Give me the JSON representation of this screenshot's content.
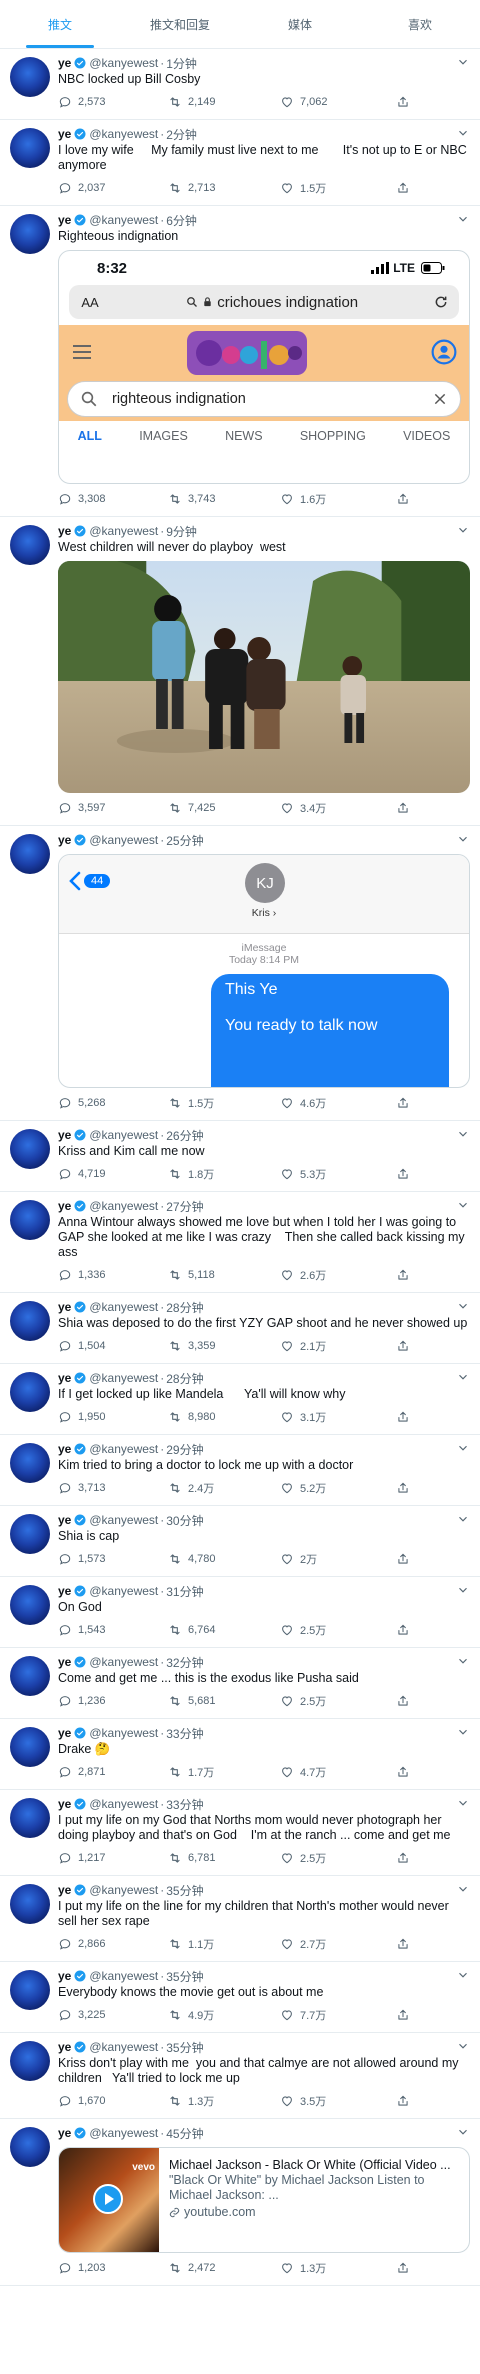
{
  "tabs": [
    {
      "label": "推文",
      "active": true
    },
    {
      "label": "推文和回复",
      "active": false
    },
    {
      "label": "媒体",
      "active": false
    },
    {
      "label": "喜欢",
      "active": false
    }
  ],
  "colors": {
    "accent": "#1d9bf0",
    "text": "#0f1419",
    "muted": "#536471",
    "border": "#e6ecf0"
  },
  "author": {
    "name": "ye",
    "handle": "@kanyewest"
  },
  "tweets": [
    {
      "time": "1分钟",
      "text": "NBC locked up Bill Cosby",
      "replies": "2,573",
      "retweets": "2,149",
      "likes": "7,062"
    },
    {
      "time": "2分钟",
      "text": "I love my wife     My family must live next to me       It's not up to E or NBC anymore",
      "replies": "2,037",
      "retweets": "2,713",
      "likes": "1.5万"
    },
    {
      "time": "6分钟",
      "text": "Righteous indignation",
      "replies": "3,308",
      "retweets": "3,743",
      "likes": "1.6万"
    },
    {
      "time": "9分钟",
      "text": "West children will never do playboy  west",
      "replies": "3,597",
      "retweets": "7,425",
      "likes": "3.4万"
    },
    {
      "time": "25分钟",
      "text": "",
      "replies": "5,268",
      "retweets": "1.5万",
      "likes": "4.6万"
    },
    {
      "time": "26分钟",
      "text": "Kriss and Kim call me now",
      "replies": "4,719",
      "retweets": "1.8万",
      "likes": "5.3万"
    },
    {
      "time": "27分钟",
      "text": "Anna Wintour always showed me love but when I told her I was going to GAP she looked at me like I was crazy    Then she called back kissing my ass",
      "replies": "1,336",
      "retweets": "5,118",
      "likes": "2.6万"
    },
    {
      "time": "28分钟",
      "text": "Shia was deposed to do the first YZY GAP shoot and he never showed up",
      "replies": "1,504",
      "retweets": "3,359",
      "likes": "2.1万"
    },
    {
      "time": "28分钟",
      "text": "If I get locked up like Mandela      Ya'll will know why",
      "replies": "1,950",
      "retweets": "8,980",
      "likes": "3.1万"
    },
    {
      "time": "29分钟",
      "text": "Kim tried to bring a doctor to lock me up with a doctor",
      "replies": "3,713",
      "retweets": "2.4万",
      "likes": "5.2万"
    },
    {
      "time": "30分钟",
      "text": "Shia is cap",
      "replies": "1,573",
      "retweets": "4,780",
      "likes": "2万"
    },
    {
      "time": "31分钟",
      "text": "On God",
      "replies": "1,543",
      "retweets": "6,764",
      "likes": "2.5万"
    },
    {
      "time": "32分钟",
      "text": "Come and get me ... this is the exodus like Pusha said",
      "replies": "1,236",
      "retweets": "5,681",
      "likes": "2.5万"
    },
    {
      "time": "33分钟",
      "text": "Drake 🤔",
      "replies": "2,871",
      "retweets": "1.7万",
      "likes": "4.7万"
    },
    {
      "time": "33分钟",
      "text": "I put my life on my God that Norths mom would never photograph her doing playboy and that's on God    I'm at the ranch ... come and get me",
      "replies": "1,217",
      "retweets": "6,781",
      "likes": "2.5万"
    },
    {
      "time": "35分钟",
      "text": "I put my life on the line for my children that North's mother would never sell her sex rape",
      "replies": "2,866",
      "retweets": "1.1万",
      "likes": "2.7万"
    },
    {
      "time": "35分钟",
      "text": "Everybody knows the movie get out is about me",
      "replies": "3,225",
      "retweets": "4.9万",
      "likes": "7.7万"
    },
    {
      "time": "35分钟",
      "text": "Kriss don't play with me  you and that calmye are not allowed around my children   Ya'll tried to lock me up",
      "replies": "1,670",
      "retweets": "1.3万",
      "likes": "3.5万"
    },
    {
      "time": "45分钟",
      "text": "",
      "replies": "1,203",
      "retweets": "2,472",
      "likes": "1.3万"
    }
  ],
  "phone_shot": {
    "clock": "8:32",
    "network": "LTE",
    "aa": "AA",
    "url": "crichoues indignation",
    "search_query": "righteous indignation",
    "tabs": [
      "ALL",
      "IMAGES",
      "NEWS",
      "SHOPPING",
      "VIDEOS"
    ]
  },
  "imessage": {
    "back_count": "44",
    "initials": "KJ",
    "contact": "Kris ›",
    "service": "iMessage",
    "timestamp": "Today 8:14 PM",
    "line1": "This Ye",
    "line2": "You ready to talk now"
  },
  "link_card": {
    "title": "Michael Jackson - Black Or White (Official Video ...",
    "desc": "\"Black Or White\" by Michael Jackson Listen to Michael Jackson: ...",
    "domain": "youtube.com",
    "thumb_label": "vevo"
  }
}
